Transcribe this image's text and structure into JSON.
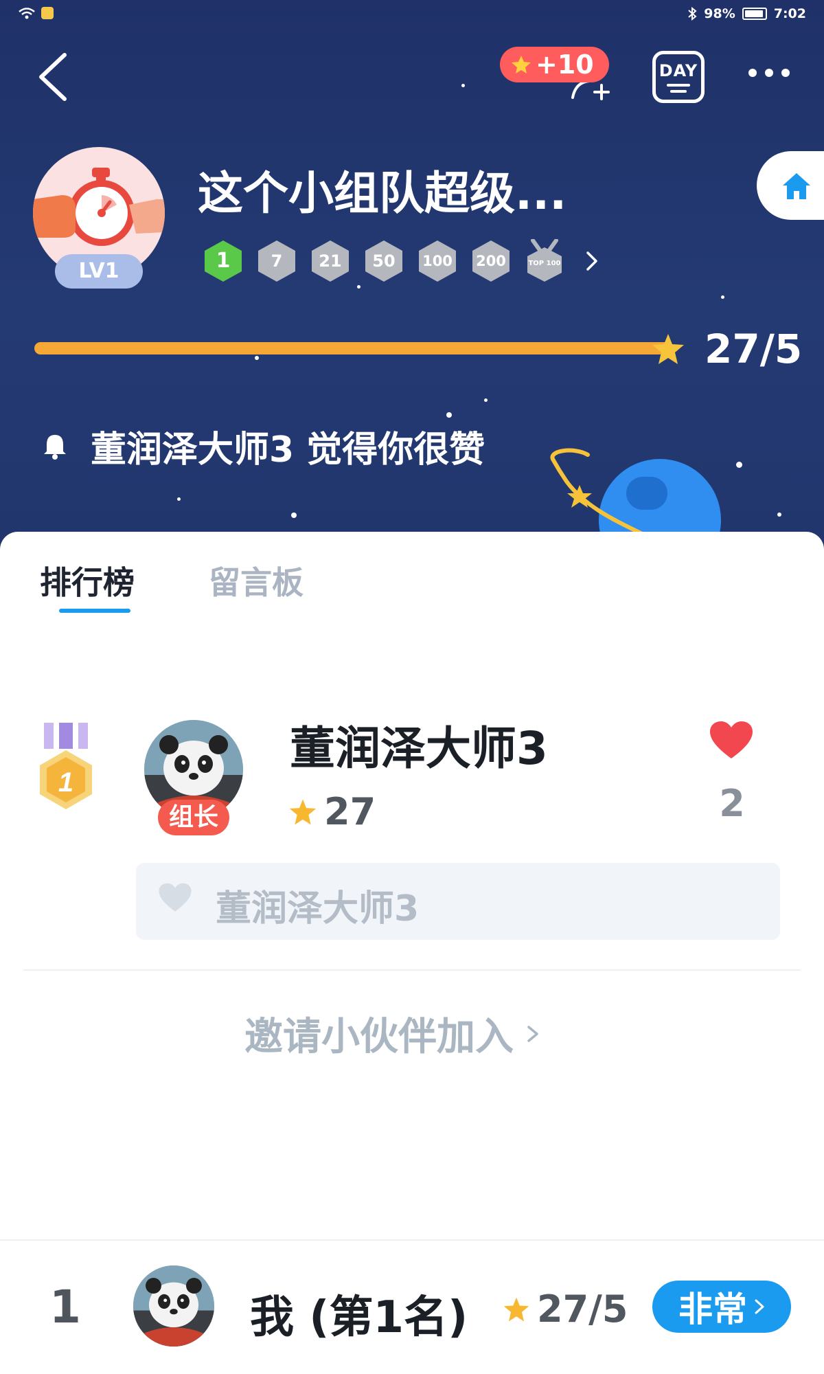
{
  "status_bar": {
    "battery": "98%",
    "time": "7:02"
  },
  "header": {
    "bonus_label": "+10",
    "day_label": "DAY",
    "group_title": "这个小组队超级...",
    "level_badge": "LV1",
    "medals": [
      "1",
      "7",
      "21",
      "50",
      "100",
      "200",
      "TOP 100"
    ],
    "progress": {
      "value": 27,
      "target": 5,
      "text": "27/5"
    },
    "notice": "董润泽大师3 觉得你很赞"
  },
  "tabs": [
    {
      "label": "排行榜",
      "active": true
    },
    {
      "label": "留言板",
      "active": false
    }
  ],
  "leaderboard": [
    {
      "rank": 1,
      "name": "董润泽大师3",
      "role_badge": "组长",
      "score": "27",
      "likes": "2",
      "liked_by": "董润泽大师3"
    }
  ],
  "invite_label": "邀请小伙伴加入",
  "bottom_bar": {
    "rank": "1",
    "label": "我 (第1名)",
    "score": "27/5",
    "button_label": "非常"
  },
  "colors": {
    "header_bg": "#243a73",
    "accent_blue": "#1a9bf0",
    "progress": "#f5a836",
    "bonus_red": "#ff5d5d",
    "leader_red": "#f55a4e",
    "heart_red": "#f2474f",
    "medal_green": "#5ac94a",
    "medal_gray": "#b4b7bd"
  },
  "icons": {
    "back": "chevron-left-icon",
    "add_friend": "add-user-icon",
    "day": "calendar-day-icon",
    "more": "more-icon",
    "home": "home-icon",
    "notice": "bell-icon",
    "like": "heart-icon",
    "score": "star-icon"
  }
}
